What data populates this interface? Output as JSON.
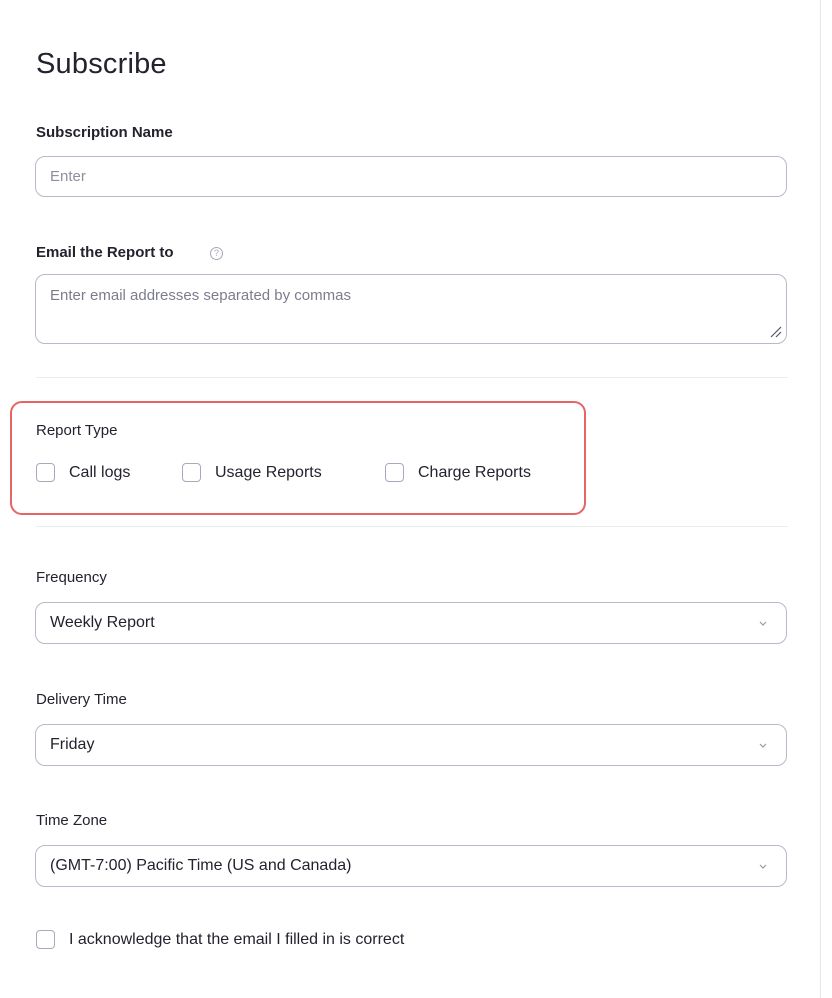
{
  "page": {
    "title": "Subscribe"
  },
  "subscription_name": {
    "label": "Subscription Name",
    "placeholder": "Enter",
    "value": ""
  },
  "email": {
    "label": "Email the Report to",
    "help_icon": "question-circle-icon",
    "placeholder": "Enter email addresses separated by commas",
    "value": ""
  },
  "report_type": {
    "label": "Report Type",
    "options": [
      {
        "label": "Call logs",
        "checked": false
      },
      {
        "label": "Usage Reports",
        "checked": false
      },
      {
        "label": "Charge Reports",
        "checked": false
      }
    ],
    "highlight_color": "#e56565"
  },
  "frequency": {
    "label": "Frequency",
    "selected": "Weekly Report"
  },
  "delivery_time": {
    "label": "Delivery Time",
    "selected": "Friday"
  },
  "time_zone": {
    "label": "Time Zone",
    "selected": "(GMT-7:00) Pacific Time (US and Canada)"
  },
  "acknowledge": {
    "label": "I acknowledge that the email I filled in is correct",
    "checked": false
  }
}
